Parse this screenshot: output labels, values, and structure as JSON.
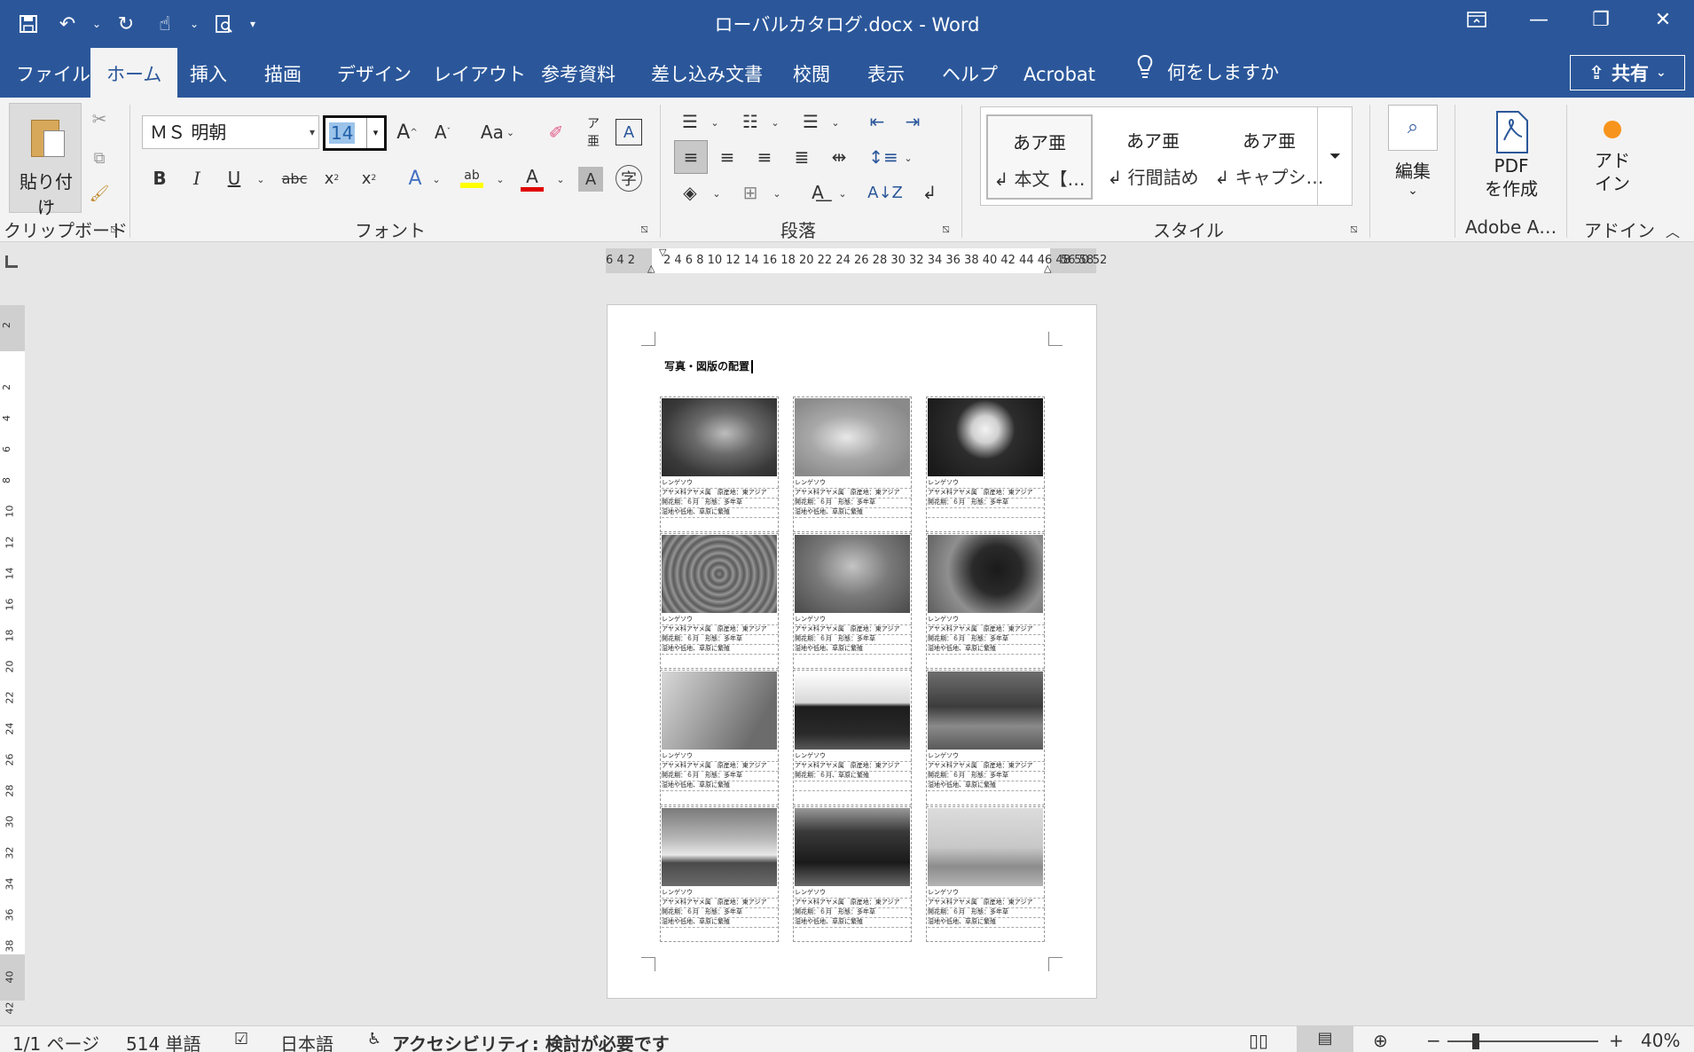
{
  "window": {
    "title": "ローバルカタログ.docx  -  Word"
  },
  "tabs": [
    {
      "label": "ファイル"
    },
    {
      "label": "ホーム"
    },
    {
      "label": "挿入"
    },
    {
      "label": "描画"
    },
    {
      "label": "デザイン"
    },
    {
      "label": "レイアウト"
    },
    {
      "label": "参考資料"
    },
    {
      "label": "差し込み文書"
    },
    {
      "label": "校閲"
    },
    {
      "label": "表示"
    },
    {
      "label": "ヘルプ"
    },
    {
      "label": "Acrobat"
    }
  ],
  "tell_me": "何をしますか",
  "share_label": "共有",
  "ribbon": {
    "clipboard": {
      "paste_label": "貼り付け",
      "group_label": "クリップボード"
    },
    "font": {
      "font_name": "ＭＳ 明朝",
      "font_size": "14",
      "group_label": "フォント",
      "clear_label": "Aa"
    },
    "paragraph": {
      "group_label": "段落"
    },
    "styles": {
      "group_label": "スタイル",
      "items": [
        {
          "sample": "あア亜",
          "name": "↲ 本文【…"
        },
        {
          "sample": "あア亜",
          "name": "↲ 行間詰め"
        },
        {
          "sample": "あア亜",
          "name": "↲ キャプシ…"
        }
      ]
    },
    "editing": {
      "label": "編集"
    },
    "pdf": {
      "label_line1": "PDF",
      "label_line2": "を作成",
      "group_label": "Adobe A…"
    },
    "addin": {
      "label_line1": "アド",
      "label_line2": "イン",
      "group_label": "アドイン"
    }
  },
  "ruler": {
    "left_numbers": "6 4 2",
    "numbers": "2  4  6  8 10 12 14 16 18 20 22 24 26 28 30 32 34 36 38 40 42 44 46 48 50 52",
    "right_numbers": "56 58",
    "vertical_numbers": [
      "2",
      "2",
      "4",
      "6",
      "8",
      "10",
      "12",
      "14",
      "16",
      "18",
      "20",
      "22",
      "24",
      "26",
      "28",
      "30",
      "32",
      "34",
      "36",
      "38",
      "40",
      "42"
    ]
  },
  "document": {
    "heading": "写真・図版の配置",
    "cells": [
      {
        "name": "レンゲソウ",
        "l1": "アヤメ科アヤメ属　原産地：東アジア",
        "l2": "開花期：６月　形態：多年草",
        "l3": "湿地や低地、草原に繁殖"
      },
      {
        "name": "レンゲソウ",
        "l1": "アヤメ科アヤメ属　原産地：東アジア",
        "l2": "開花期：６月　形態：多年草",
        "l3": "湿地や低地、草原に繁殖"
      },
      {
        "name": "レンゲソウ",
        "l1": "アヤメ科アヤメ属　原産地：東アジア",
        "l2": "開花期：６月　形態：多年草",
        "l3": ""
      },
      {
        "name": "レンゲソウ",
        "l1": "アヤメ科アヤメ属　原産地：東アジア",
        "l2": "開花期：６月　形態：多年草",
        "l3": "湿地や低地、草原に繁殖"
      },
      {
        "name": "レンゲソウ",
        "l1": "アヤメ科アヤメ属　原産地：東アジア",
        "l2": "開花期：６月　形態：多年草",
        "l3": "湿地や低地、草原に繁殖"
      },
      {
        "name": "レンゲソウ",
        "l1": "アヤメ科アヤメ属　原産地：東アジア",
        "l2": "開花期：６月　形態：多年草",
        "l3": "湿地や低地、草原に繁殖"
      },
      {
        "name": "レンゲソウ",
        "l1": "アヤメ科アヤメ属　原産地：東アジア",
        "l2": "開花期：６月　形態：多年草",
        "l3": "湿地や低地、草原に繁殖"
      },
      {
        "name": "レンゲソウ",
        "l1": "アヤメ科アヤメ属　原産地：東アジア",
        "l2": "開花期：６月、草原に繁殖",
        "l3": ""
      },
      {
        "name": "レンゲソウ",
        "l1": "アヤメ科アヤメ属　原産地：東アジア",
        "l2": "開花期：６月　形態：多年草",
        "l3": "湿地や低地、草原に繁殖"
      },
      {
        "name": "レンゲソウ",
        "l1": "アヤメ科アヤメ属　原産地：東アジア",
        "l2": "開花期：６月　形態：多年草",
        "l3": "湿地や低地、草原に繁殖"
      },
      {
        "name": "レンゲソウ",
        "l1": "アヤメ科アヤメ属　原産地：東アジア",
        "l2": "開花期：６月　形態：多年草",
        "l3": "湿地や低地、草原に繁殖"
      },
      {
        "name": "レンゲソウ",
        "l1": "アヤメ科アヤメ属　原産地：東アジア",
        "l2": "開花期：６月　形態：多年草",
        "l3": "湿地や低地、草原に繁殖"
      }
    ]
  },
  "status": {
    "page": "1/1 ページ",
    "words": "514 単語",
    "language": "日本語",
    "accessibility": "アクセシビリティ: 検討が必要です",
    "zoom": "40%"
  },
  "colors": {
    "title_bar": "#2b579a",
    "ribbon_bg": "#f3f3f3",
    "highlight_yellow": "#ffff00",
    "font_red": "#e00000"
  }
}
